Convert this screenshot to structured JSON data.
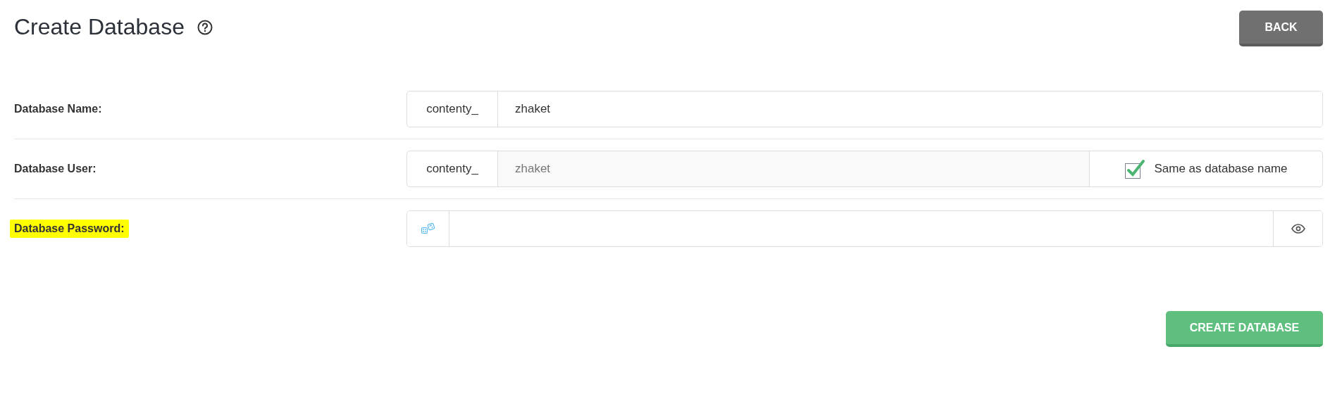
{
  "title": "Create Database",
  "back_button": "BACK",
  "fields": [
    {
      "kind": "prefixed",
      "label": "Database Name:",
      "prefix": "contenty_",
      "value": "zhaket",
      "disabled": false,
      "highlighted": false
    },
    {
      "kind": "prefixed",
      "label": "Database User:",
      "prefix": "contenty_",
      "value": "zhaket",
      "disabled": true,
      "highlighted": false,
      "checkbox": {
        "label": "Same as database name",
        "checked": true
      }
    },
    {
      "kind": "password",
      "label": "Database Password:",
      "highlighted": true
    }
  ],
  "submit_button": "CREATE DATABASE"
}
